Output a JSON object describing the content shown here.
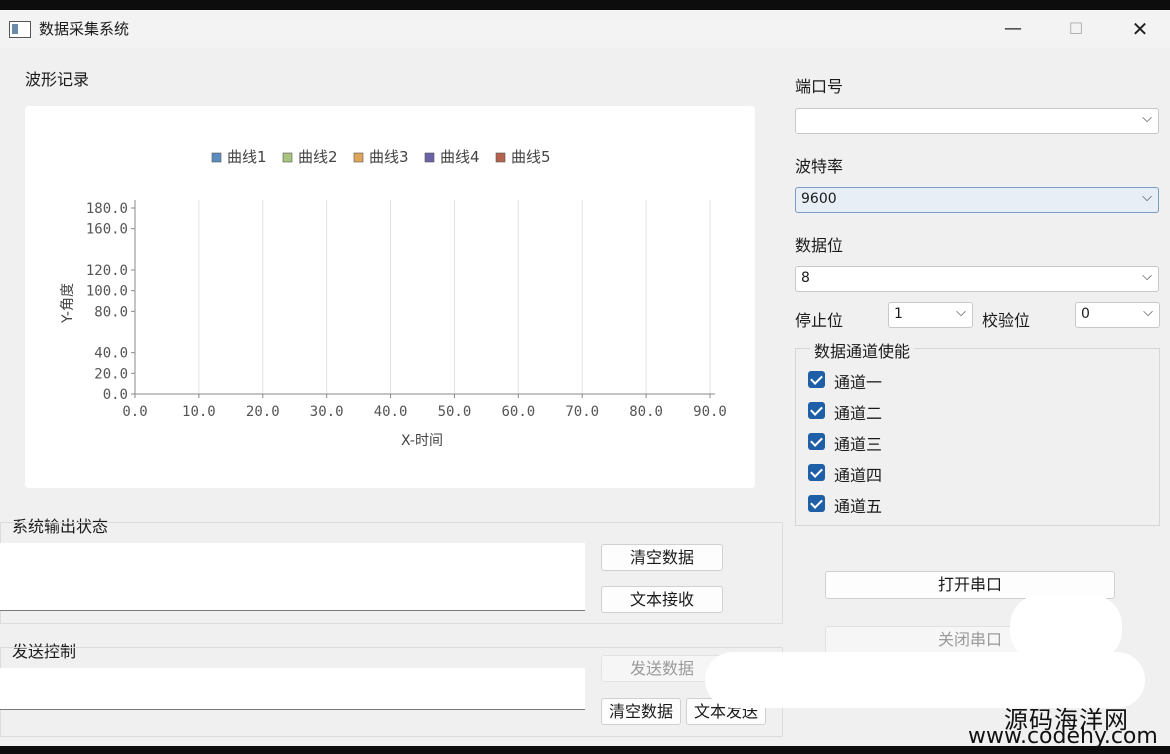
{
  "window": {
    "title": "数据采集系统",
    "min_glyph": "—",
    "max_glyph": "☐",
    "close_glyph": "✕"
  },
  "waveform": {
    "section_label": "波形记录",
    "chart_data": {
      "type": "line",
      "legend": [
        "曲线1",
        "曲线2",
        "曲线3",
        "曲线4",
        "曲线5"
      ],
      "legend_colors": [
        "#5b8cc0",
        "#a9c47f",
        "#e0a45a",
        "#6a63a8",
        "#b5634f"
      ],
      "xlabel": "X-时间",
      "ylabel": "Y-角度",
      "xlim": [
        0,
        90
      ],
      "ylim": [
        0,
        180
      ],
      "x_ticks": [
        "0.0",
        "10.0",
        "20.0",
        "30.0",
        "40.0",
        "50.0",
        "60.0",
        "70.0",
        "80.0",
        "90.0"
      ],
      "y_ticks": [
        {
          "v": 0,
          "t": "0.0"
        },
        {
          "v": 20,
          "t": "20.0"
        },
        {
          "v": 40,
          "t": "40.0"
        },
        {
          "v": 80,
          "t": "80.0"
        },
        {
          "v": 100,
          "t": "100.0"
        },
        {
          "v": 120,
          "t": "120.0"
        },
        {
          "v": 160,
          "t": "160.0"
        },
        {
          "v": 180,
          "t": "180.0"
        }
      ],
      "series": [],
      "grid": "vertical",
      "legend_position": "top"
    }
  },
  "serial": {
    "port_label": "端口号",
    "port_value": "",
    "baud_label": "波特率",
    "baud_value": "9600",
    "databits_label": "数据位",
    "databits_value": "8",
    "stopbits_label": "停止位",
    "stopbits_value": "1",
    "parity_label": "校验位",
    "parity_value": "0",
    "chevron": "⌵"
  },
  "channels": {
    "title": "数据通道使能",
    "items": [
      {
        "label": "通道一",
        "checked": true
      },
      {
        "label": "通道二",
        "checked": true
      },
      {
        "label": "通道三",
        "checked": true
      },
      {
        "label": "通道四",
        "checked": true
      },
      {
        "label": "通道五",
        "checked": true
      }
    ]
  },
  "output": {
    "section_label": "系统输出状态",
    "clear_label": "清空数据",
    "text_recv_label": "文本接收"
  },
  "send": {
    "section_label": "发送控制",
    "send_label": "发送数据",
    "clear_label": "清空数据",
    "text_send_label": "文本发送"
  },
  "port_actions": {
    "open_label": "打开串口",
    "close_label": "关闭串口"
  },
  "watermark": {
    "line1": "源码海洋网",
    "line2": "www.codehy.com"
  }
}
